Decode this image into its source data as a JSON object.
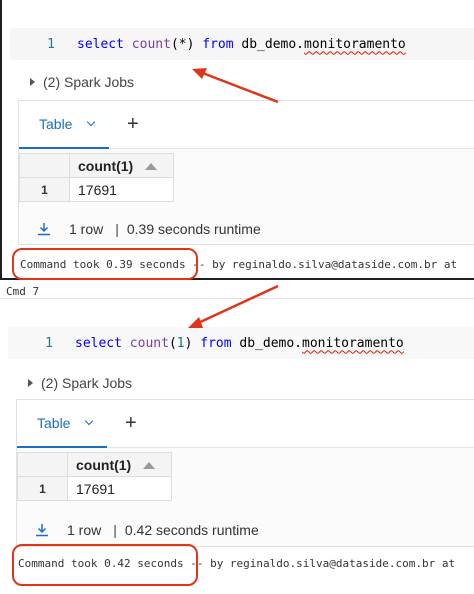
{
  "cells": [
    {
      "line_number": "1",
      "code": {
        "select": "select",
        "count": "count",
        "arg_open": "(",
        "arg": "*",
        "arg_close": ")",
        "from": "from",
        "table_ns": "db_demo.",
        "table_name": "monitoramento"
      },
      "spark_jobs": "(2) Spark Jobs",
      "tab_label": "Table",
      "add_tab": "+",
      "column_header": "count(1)",
      "row_index": "1",
      "row_value": "17691",
      "row_count": "1 row",
      "separator": "|",
      "runtime": "0.39 seconds runtime",
      "command_took": "Command took 0.39 seconds",
      "by_line": " -- by reginaldo.silva@dataside.com.br at"
    },
    {
      "line_number": "1",
      "code": {
        "select": "select",
        "count": "count",
        "arg_open": "(",
        "arg": "1",
        "arg_close": ")",
        "from": "from",
        "table_ns": "db_demo.",
        "table_name": "monitoramento"
      },
      "spark_jobs": "(2) Spark Jobs",
      "tab_label": "Table",
      "add_tab": "+",
      "column_header": "count(1)",
      "row_index": "1",
      "row_value": "17691",
      "row_count": "1 row",
      "separator": "|",
      "runtime": "0.42 seconds runtime",
      "command_took": "Command took 0.42 seconds",
      "by_line": " -- by reginaldo.silva@dataside.com.br at"
    }
  ],
  "cmd_label": "Cmd 7",
  "colors": {
    "annotation": "#e0341b",
    "tab_active": "#1b6ec2"
  }
}
